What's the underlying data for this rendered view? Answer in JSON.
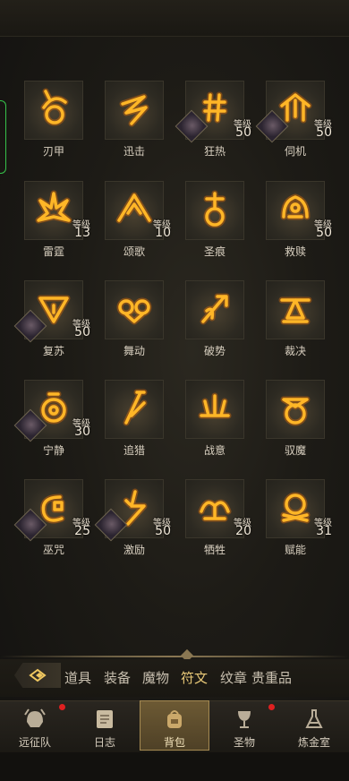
{
  "level_label": "等级",
  "runes": [
    {
      "name": "刃甲",
      "level": null,
      "equipped": false
    },
    {
      "name": "迅击",
      "level": null,
      "equipped": false
    },
    {
      "name": "狂热",
      "level": "50",
      "equipped": true
    },
    {
      "name": "伺机",
      "level": "50",
      "equipped": true
    },
    {
      "name": "雷霆",
      "level": "13",
      "equipped": false
    },
    {
      "name": "颂歌",
      "level": "10",
      "equipped": false
    },
    {
      "name": "圣痕",
      "level": null,
      "equipped": false
    },
    {
      "name": "救赎",
      "level": "50",
      "equipped": false
    },
    {
      "name": "复苏",
      "level": "50",
      "equipped": true
    },
    {
      "name": "舞动",
      "level": null,
      "equipped": false
    },
    {
      "name": "破势",
      "level": null,
      "equipped": false
    },
    {
      "name": "裁决",
      "level": null,
      "equipped": false
    },
    {
      "name": "宁静",
      "level": "30",
      "equipped": true
    },
    {
      "name": "追猎",
      "level": null,
      "equipped": false
    },
    {
      "name": "战意",
      "level": null,
      "equipped": false
    },
    {
      "name": "驭魔",
      "level": null,
      "equipped": false
    },
    {
      "name": "巫咒",
      "level": "25",
      "equipped": true
    },
    {
      "name": "激励",
      "level": "50",
      "equipped": true
    },
    {
      "name": "牺牲",
      "level": "20",
      "equipped": false
    },
    {
      "name": "赋能",
      "level": "31",
      "equipped": false
    }
  ],
  "categories": [
    {
      "label": "道具",
      "active": false
    },
    {
      "label": "装备",
      "active": false
    },
    {
      "label": "魔物",
      "active": false
    },
    {
      "label": "符文",
      "active": true
    },
    {
      "label": "纹章",
      "active": false
    },
    {
      "label": "贵重品",
      "active": false
    }
  ],
  "nav": [
    {
      "label": "远征队",
      "icon": "helmet-icon",
      "active": false,
      "badge": true
    },
    {
      "label": "日志",
      "icon": "scroll-icon",
      "active": false,
      "badge": false
    },
    {
      "label": "背包",
      "icon": "backpack-icon",
      "active": true,
      "badge": false
    },
    {
      "label": "圣物",
      "icon": "chalice-icon",
      "active": false,
      "badge": true
    },
    {
      "label": "炼金室",
      "icon": "alchemy-icon",
      "active": false,
      "badge": false
    }
  ],
  "colors": {
    "glyph": "#ffb627",
    "glyph_glow": "#ff7a00",
    "active_tab": "#e9c978",
    "badge": "#e02020"
  }
}
